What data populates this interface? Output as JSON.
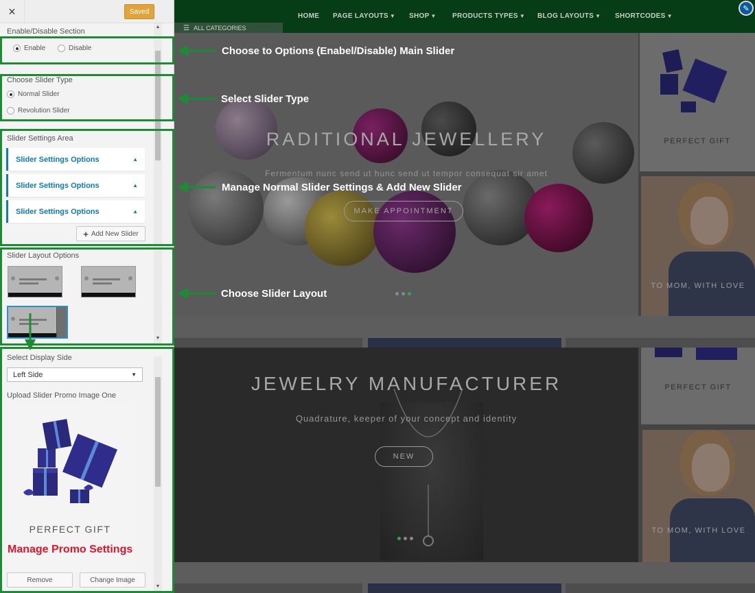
{
  "panel": {
    "close_glyph": "×",
    "saved_label": "Saved",
    "enable_section": {
      "label": "Enable/Disable Section",
      "options": [
        "Enable",
        "Disable"
      ],
      "selected": "Enable"
    },
    "slider_type": {
      "label": "Choose Slider Type",
      "options": [
        "Normal Slider",
        "Revolution Slider"
      ],
      "selected": "Normal Slider"
    },
    "settings_area": {
      "label": "Slider Settings Area",
      "items": [
        "Slider Settings Options",
        "Slider Settings Options",
        "Slider Settings Options"
      ],
      "add_button": "Add New Slider"
    },
    "layout_options": {
      "label": "Slider Layout Options"
    },
    "display_side": {
      "label": "Select Display Side",
      "value": "Left Side"
    },
    "promo": {
      "label": "Upload Slider Promo Image One",
      "caption": "PERFECT GIFT",
      "remove_label": "Remove",
      "change_label": "Change Image"
    }
  },
  "annotations": {
    "enable": "Choose to Options (Enabel/Disable) Main Slider",
    "type": "Select Slider Type",
    "settings": "Manage Normal Slider Settings & Add New Slider",
    "layout": "Choose Slider Layout",
    "promo": "Manage Promo Settings"
  },
  "preview": {
    "nav": [
      "HOME",
      "PAGE LAYOUTS",
      "SHOP",
      "PRODUCTS TYPES",
      "BLOG LAYOUTS",
      "SHORTCODES"
    ],
    "all_categories": "ALL CATEGORIES",
    "slide1": {
      "title": "RADITIONAL JEWELLERY",
      "subtitle": "Fermentum nunc send ut hunc send ut tempor consequat sir amet",
      "button": "MAKE APPOINTMENT"
    },
    "slide2": {
      "title": "JEWELRY MANUFACTURER",
      "subtitle": "Quadrature, keeper of your concept and identity",
      "button": "NEW"
    },
    "side_captions": {
      "gift": "PERFECT GIFT",
      "mom": "TO MOM, WITH LOVE"
    }
  },
  "colors": {
    "accent_green": "#1d8a34",
    "link_blue": "#0e7ab8",
    "saved_orange": "#e0a43a",
    "promo_red": "#e0152b",
    "nav_green": "#063d17"
  }
}
